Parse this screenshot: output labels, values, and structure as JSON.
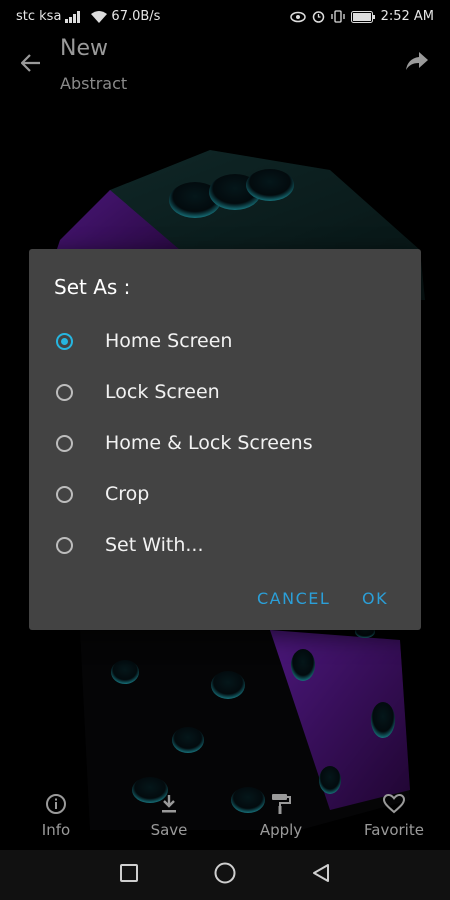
{
  "status_bar": {
    "carrier": "stc ksa",
    "network_speed": "67.0B/s",
    "time": "2:52 AM"
  },
  "app_bar": {
    "title": "New",
    "subtitle": "Abstract"
  },
  "dialog": {
    "title": "Set As :",
    "options": [
      {
        "label": "Home Screen",
        "selected": true
      },
      {
        "label": "Lock Screen",
        "selected": false
      },
      {
        "label": "Home & Lock Screens",
        "selected": false
      },
      {
        "label": "Crop",
        "selected": false
      },
      {
        "label": "Set With...",
        "selected": false
      }
    ],
    "cancel_label": "CANCEL",
    "ok_label": "OK"
  },
  "bottom_actions": {
    "info": "Info",
    "save": "Save",
    "apply": "Apply",
    "favorite": "Favorite"
  },
  "colors": {
    "accent": "#26b6e0",
    "button_text": "#2b9fd8",
    "dialog_bg": "#434343",
    "wallpaper_purple": "#7a1fb5",
    "wallpaper_teal": "#1d4a4a"
  }
}
